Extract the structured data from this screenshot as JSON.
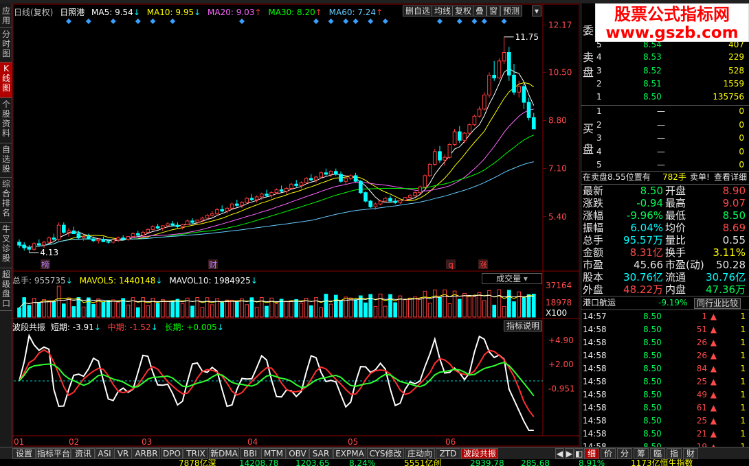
{
  "header": {
    "period": "日线(复权)",
    "stock": "日照港",
    "ma5": "MA5: 9.54",
    "ma10": "MA10: 9.95",
    "ma20": "MA20: 9.03",
    "ma30": "MA30: 8.20",
    "ma60": "MA60: 7.24",
    "buttons": [
      "删自选",
      "均线",
      "复权",
      "叠",
      "窗",
      "预测"
    ]
  },
  "sidebar": {
    "tabs": [
      "应用",
      "分时图",
      "K线图",
      "个股资料",
      "自选股",
      "综合排名",
      "牛叉诊股",
      "超级盘口"
    ]
  },
  "price_axis": [
    "12.17",
    "10.50",
    "8.80",
    "7.10",
    "5.40"
  ],
  "price_labels": {
    "high": "11.75",
    "low": "4.13"
  },
  "event_markers": [
    "榜",
    "财",
    "q",
    "涨"
  ],
  "volume": {
    "total": "总手: 955735",
    "mavol5": "MAVOL5: 1440148",
    "mavol10": "MAVOL10: 1984925",
    "axis": [
      "37164",
      "18978",
      "X100"
    ],
    "dropdown": "成交量"
  },
  "indicator": {
    "name": "波段共振",
    "short": "短期: -3.91",
    "mid": "中期: -1.52",
    "long": "长期: +0.005",
    "button": "指标说明",
    "axis": [
      "+4.90",
      "+2.00",
      "-0.951"
    ]
  },
  "months": [
    "01",
    "02",
    "03",
    "04",
    "05",
    "06"
  ],
  "logo": {
    "title": "股票公式指标网",
    "url": "www.gszb.com"
  },
  "orderbook": {
    "sell_label": "卖盘",
    "buy_label": "买盘",
    "wei_label": "委",
    "sells": [
      {
        "lvl": "5",
        "price": "8.54",
        "vol": "407"
      },
      {
        "lvl": "4",
        "price": "8.53",
        "vol": "229"
      },
      {
        "lvl": "3",
        "price": "8.52",
        "vol": "528"
      },
      {
        "lvl": "2",
        "price": "8.51",
        "vol": "1559"
      },
      {
        "lvl": "1",
        "price": "8.50",
        "vol": "135756"
      }
    ],
    "buys": [
      {
        "lvl": "1",
        "price": "—",
        "vol": "0"
      },
      {
        "lvl": "2",
        "price": "—",
        "vol": "0"
      },
      {
        "lvl": "3",
        "price": "—",
        "vol": "0"
      },
      {
        "lvl": "4",
        "price": "—",
        "vol": "0"
      },
      {
        "lvl": "5",
        "price": "—",
        "vol": "0"
      }
    ]
  },
  "position": {
    "left": "在卖盘8.55位置有",
    "vol": "782手",
    "sell": "卖单!",
    "detail": "查看详细"
  },
  "stats": [
    {
      "l1": "最新",
      "v1": "8.50",
      "l2": "开盘",
      "v2": "8.90"
    },
    {
      "l1": "涨跌",
      "v1": "-0.94",
      "l2": "最高",
      "v2": "9.07"
    },
    {
      "l1": "涨幅",
      "v1": "-9.96%",
      "l2": "最低",
      "v2": "8.50"
    },
    {
      "l1": "振幅",
      "v1": "6.04%",
      "l2": "均价",
      "v2": "8.69"
    },
    {
      "l1": "总手",
      "v1": "95.57万",
      "l2": "量比",
      "v2": "0.55"
    },
    {
      "l1": "金额",
      "v1": "8.31亿",
      "l2": "换手",
      "v2": "3.11%"
    },
    {
      "l1": "市盈",
      "v1": "45.66",
      "l2": "市盈(动)",
      "v2": "50.28"
    },
    {
      "l1": "股本",
      "v1": "30.76亿",
      "l2": "流通",
      "v2": "30.76亿"
    },
    {
      "l1": "外盘",
      "v1": "48.22万",
      "l2": "内盘",
      "v2": "47.36万"
    }
  ],
  "sector": {
    "name": "港口航运",
    "change": "-9.19%",
    "button": "同行业比较"
  },
  "ticks": [
    {
      "time": "14:57",
      "price": "8.50",
      "vol": "1",
      "n": "1"
    },
    {
      "time": "14:58",
      "price": "8.50",
      "vol": "51",
      "n": "1"
    },
    {
      "time": "14:58",
      "price": "8.50",
      "vol": "26",
      "n": "1"
    },
    {
      "time": "14:58",
      "price": "8.50",
      "vol": "26",
      "n": "1"
    },
    {
      "time": "14:58",
      "price": "8.50",
      "vol": "84",
      "n": "1"
    },
    {
      "time": "14:58",
      "price": "8.50",
      "vol": "25",
      "n": "1"
    },
    {
      "time": "14:58",
      "price": "8.50",
      "vol": "49",
      "n": "1"
    },
    {
      "time": "14:58",
      "price": "8.50",
      "vol": "61",
      "n": "1"
    },
    {
      "time": "14:58",
      "price": "8.50",
      "vol": "25",
      "n": "1"
    },
    {
      "time": "14:58",
      "price": "8.50",
      "vol": "21",
      "n": "1"
    },
    {
      "time": "14:58",
      "price": "8.50",
      "vol": "19",
      "n": "1"
    }
  ],
  "bottom_tabs": [
    "设置",
    "指标平台",
    "资讯",
    "ASI",
    "VR",
    "ARBR",
    "DPO",
    "TRIX",
    "新DMA",
    "BBI",
    "MTM",
    "OBV",
    "SAR",
    "EXPMA",
    "CYS修改",
    "庄动向",
    "ZTD",
    "波段共振"
  ],
  "right_tabs": [
    "细",
    "价",
    "分",
    "筹",
    "臨",
    "指",
    "财"
  ],
  "status_items": [
    "7878亿深",
    "14208.78",
    "1203.65",
    "8.24%",
    "5551亿创",
    "2939.78",
    "285.68",
    "8.91%",
    "1173亿恒生指数"
  ],
  "colors": {
    "up": "#ff3c3c",
    "down": "#00ffff",
    "ma5": "#ffffff",
    "ma10": "#ffff00",
    "ma20": "#ff66ff",
    "ma30": "#00ff00",
    "ma60": "#66ccff"
  },
  "chart_data": {
    "type": "candlestick",
    "x_axis_months": [
      "01",
      "02",
      "03",
      "04",
      "05",
      "06"
    ],
    "price_ylim": [
      4.13,
      12.17
    ],
    "price_high_marked": 11.75,
    "price_low_marked": 4.13,
    "ohlc": [
      [
        4.5,
        4.6,
        4.3,
        4.4
      ],
      [
        4.4,
        4.5,
        4.2,
        4.3
      ],
      [
        4.3,
        4.4,
        4.13,
        4.25
      ],
      [
        4.25,
        4.5,
        4.2,
        4.45
      ],
      [
        4.45,
        4.6,
        4.35,
        4.4
      ],
      [
        4.4,
        4.55,
        4.3,
        4.5
      ],
      [
        4.5,
        4.7,
        4.45,
        4.65
      ],
      [
        4.65,
        4.8,
        4.55,
        4.6
      ],
      [
        4.6,
        5.2,
        4.55,
        5.1
      ],
      [
        5.1,
        5.2,
        4.8,
        4.85
      ],
      [
        4.85,
        5.0,
        4.7,
        4.9
      ],
      [
        4.9,
        5.05,
        4.8,
        4.8
      ],
      [
        4.8,
        4.9,
        4.6,
        4.65
      ],
      [
        4.65,
        4.75,
        4.55,
        4.7
      ],
      [
        4.7,
        4.8,
        4.6,
        4.62
      ],
      [
        4.62,
        4.7,
        4.5,
        4.55
      ],
      [
        4.55,
        4.65,
        4.45,
        4.6
      ],
      [
        4.6,
        4.7,
        4.5,
        4.52
      ],
      [
        4.52,
        4.6,
        4.45,
        4.5
      ],
      [
        4.5,
        4.62,
        4.45,
        4.58
      ],
      [
        4.58,
        4.7,
        4.5,
        4.65
      ],
      [
        4.65,
        4.75,
        4.55,
        4.6
      ],
      [
        4.6,
        4.72,
        4.55,
        4.7
      ],
      [
        4.7,
        4.85,
        4.65,
        4.8
      ],
      [
        4.8,
        4.9,
        4.7,
        4.75
      ],
      [
        4.75,
        4.9,
        4.7,
        4.85
      ],
      [
        4.85,
        5.0,
        4.8,
        4.95
      ],
      [
        4.95,
        5.1,
        4.9,
        5.05
      ],
      [
        5.05,
        5.15,
        4.95,
        5.0
      ],
      [
        5.0,
        5.1,
        4.9,
        5.08
      ],
      [
        5.08,
        5.2,
        5.0,
        5.15
      ],
      [
        5.15,
        5.25,
        5.05,
        5.1
      ],
      [
        5.1,
        5.2,
        5.0,
        5.05
      ],
      [
        5.05,
        5.15,
        4.95,
        5.12
      ],
      [
        5.12,
        5.3,
        5.1,
        5.25
      ],
      [
        5.25,
        5.35,
        5.15,
        5.2
      ],
      [
        5.2,
        5.3,
        5.1,
        5.28
      ],
      [
        5.28,
        5.4,
        5.2,
        5.35
      ],
      [
        5.35,
        5.5,
        5.3,
        5.45
      ],
      [
        5.45,
        5.6,
        5.4,
        5.5
      ],
      [
        5.5,
        5.7,
        5.45,
        5.65
      ],
      [
        5.65,
        5.8,
        5.55,
        5.6
      ],
      [
        5.6,
        5.75,
        5.5,
        5.7
      ],
      [
        5.7,
        5.9,
        5.65,
        5.85
      ],
      [
        5.85,
        6.0,
        5.75,
        5.8
      ],
      [
        5.8,
        5.95,
        5.7,
        5.9
      ],
      [
        5.9,
        6.1,
        5.85,
        6.05
      ],
      [
        6.05,
        6.2,
        5.95,
        6.0
      ],
      [
        6.0,
        6.15,
        5.9,
        6.1
      ],
      [
        6.1,
        6.25,
        6.0,
        6.2
      ],
      [
        6.2,
        6.35,
        6.1,
        6.15
      ],
      [
        6.15,
        6.3,
        6.05,
        6.25
      ],
      [
        6.25,
        6.4,
        6.2,
        6.35
      ],
      [
        6.35,
        6.5,
        6.25,
        6.3
      ],
      [
        6.3,
        6.45,
        6.2,
        6.4
      ],
      [
        6.4,
        6.6,
        6.35,
        6.55
      ],
      [
        6.55,
        6.7,
        6.45,
        6.5
      ],
      [
        6.5,
        6.65,
        6.4,
        6.6
      ],
      [
        6.6,
        6.8,
        6.55,
        6.75
      ],
      [
        6.75,
        6.9,
        6.65,
        6.7
      ],
      [
        6.7,
        6.85,
        6.6,
        6.8
      ],
      [
        6.8,
        7.0,
        6.75,
        6.95
      ],
      [
        6.95,
        7.1,
        6.85,
        6.9
      ],
      [
        6.9,
        7.05,
        6.8,
        7.0
      ],
      [
        7.0,
        7.1,
        6.85,
        6.9
      ],
      [
        6.9,
        7.0,
        6.6,
        6.65
      ],
      [
        6.65,
        6.8,
        6.55,
        6.75
      ],
      [
        6.75,
        6.9,
        6.7,
        6.85
      ],
      [
        6.85,
        6.95,
        6.6,
        6.65
      ],
      [
        6.65,
        6.7,
        6.2,
        6.25
      ],
      [
        6.25,
        6.3,
        5.9,
        5.95
      ],
      [
        5.95,
        6.0,
        5.7,
        5.75
      ],
      [
        5.75,
        5.9,
        5.65,
        5.85
      ],
      [
        5.85,
        6.0,
        5.8,
        5.95
      ],
      [
        5.95,
        6.1,
        5.9,
        6.05
      ],
      [
        6.05,
        6.15,
        5.9,
        5.95
      ],
      [
        5.95,
        6.05,
        5.85,
        5.9
      ],
      [
        5.9,
        6.0,
        5.85,
        5.98
      ],
      [
        5.98,
        6.1,
        5.95,
        6.08
      ],
      [
        6.08,
        6.2,
        6.0,
        6.15
      ],
      [
        6.15,
        6.3,
        6.1,
        6.25
      ],
      [
        6.25,
        6.5,
        6.2,
        6.45
      ],
      [
        6.45,
        6.9,
        6.4,
        6.85
      ],
      [
        6.85,
        7.3,
        6.8,
        7.25
      ],
      [
        7.25,
        7.8,
        7.2,
        7.7
      ],
      [
        7.7,
        7.9,
        7.3,
        7.4
      ],
      [
        7.4,
        7.6,
        7.2,
        7.5
      ],
      [
        7.5,
        8.0,
        7.45,
        7.95
      ],
      [
        7.95,
        8.5,
        7.9,
        8.4
      ],
      [
        8.4,
        8.6,
        8.0,
        8.1
      ],
      [
        8.1,
        8.4,
        8.0,
        8.35
      ],
      [
        8.35,
        8.7,
        8.3,
        8.65
      ],
      [
        8.65,
        9.0,
        8.6,
        8.95
      ],
      [
        8.95,
        9.3,
        8.9,
        9.2
      ],
      [
        9.2,
        9.8,
        9.15,
        9.7
      ],
      [
        9.7,
        10.5,
        9.6,
        10.4
      ],
      [
        10.4,
        10.9,
        10.2,
        10.3
      ],
      [
        10.3,
        11.0,
        10.25,
        10.9
      ],
      [
        10.9,
        11.75,
        10.8,
        11.2
      ],
      [
        11.2,
        11.4,
        10.2,
        10.4
      ],
      [
        10.4,
        10.8,
        9.7,
        9.8
      ],
      [
        9.8,
        10.2,
        9.6,
        10.0
      ],
      [
        10.0,
        10.1,
        9.2,
        9.44
      ],
      [
        9.44,
        9.6,
        8.8,
        8.9
      ],
      [
        8.9,
        9.07,
        8.5,
        8.5
      ]
    ],
    "volume_axis": [
      18978,
      37164
    ],
    "volume_last": 955735,
    "mavol5": 1440148,
    "mavol10": 1984925,
    "indicator": {
      "name": "波段共振",
      "axis": [
        -0.951,
        2.0,
        4.9
      ],
      "short_last": -3.91,
      "mid_last": -1.52,
      "long_last": 0.005
    }
  }
}
